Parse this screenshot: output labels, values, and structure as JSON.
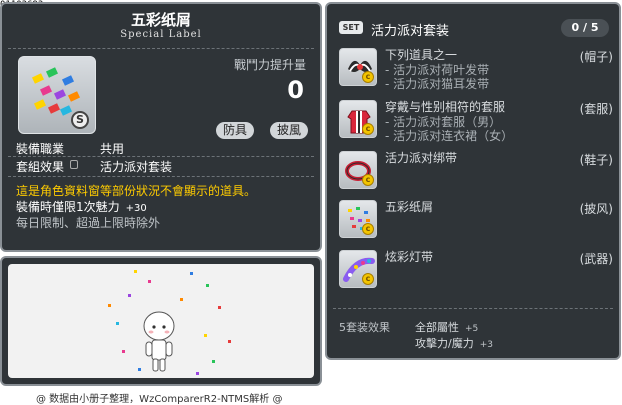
{
  "item_id": "01103693",
  "item": {
    "name": "五彩纸屑",
    "label": "Special Label",
    "power_label": "戰鬥力提升量",
    "power_value": "0",
    "tag_defense": "防具",
    "tag_cape": "披風",
    "job_label": "裝備職業",
    "job_value": "共用",
    "set_effect_label": "套組效果",
    "set_effect_value": "活力派对套装",
    "notice": "這是角色資料窗等部份狀況不會顯示的道具。",
    "charm_text": "裝備時僅限1次魅力",
    "charm_value": "+30",
    "limit_text": "每日限制、超過上限時除外"
  },
  "footer": "@ 数据由小册子整理，WzComparerR2-NTMS解析 @",
  "set": {
    "badge": "SET",
    "title": "活力派对套装",
    "count": "0 / 5",
    "items": [
      {
        "name": "下列道具之一",
        "subs": [
          "- 活力派对荷叶发带",
          "- 活力派对猫耳发带"
        ],
        "slot": "(帽子)"
      },
      {
        "name": "穿戴与性别相符的套服",
        "subs": [
          "- 活力派对套服（男）",
          "- 活力派对连衣裙（女）"
        ],
        "slot": "(套服)"
      },
      {
        "name": "活力派对绑带",
        "subs": [],
        "slot": "(鞋子)"
      },
      {
        "name": "五彩纸屑",
        "subs": [],
        "slot": "(披风)"
      },
      {
        "name": "炫彩灯带",
        "subs": [],
        "slot": "(武器)"
      }
    ],
    "bonus_label": "5套装效果",
    "bonus_1": "全部屬性",
    "bonus_1_val": "+5",
    "bonus_2": "攻擊力/魔力",
    "bonus_2_val": "+3"
  },
  "colors": {
    "panel_bg": "#2f3438",
    "panel_border": "#8a9096",
    "notice": "#ffcc00",
    "coin": "#f3c400"
  },
  "icons": {
    "main": "confetti-icon",
    "hat": "bow-headband-icon",
    "overall": "party-outfit-icon",
    "shoes": "strap-icon",
    "cape": "confetti-icon",
    "weapon": "light-string-icon"
  }
}
